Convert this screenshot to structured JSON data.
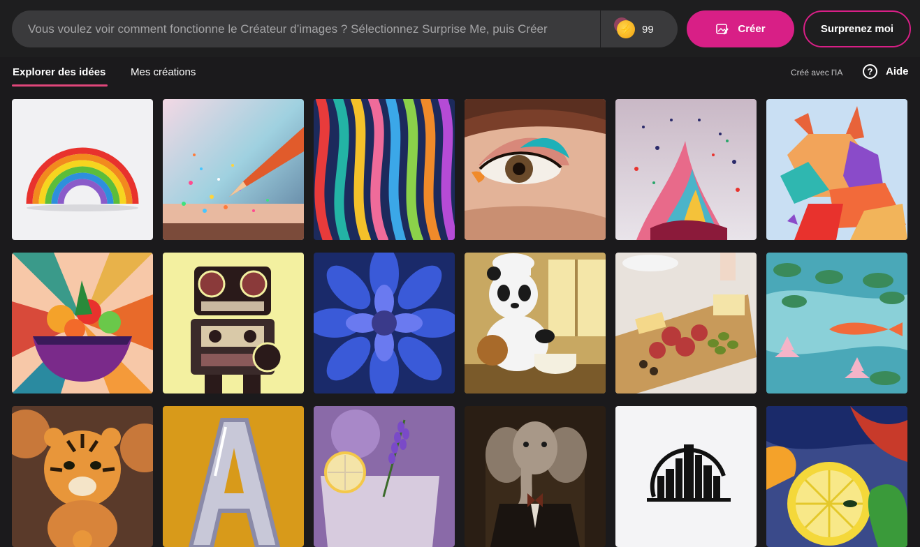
{
  "prompt": {
    "placeholder": "Vous voulez voir comment fonctionne le Créateur d’images ? Sélectionnez Surprise Me, puis Créer"
  },
  "boosts": {
    "count": "99"
  },
  "buttons": {
    "create": "Créer",
    "surprise": "Surprenez moi"
  },
  "tabs": [
    {
      "label": "Explorer des idées",
      "active": true
    },
    {
      "label": "Mes créations",
      "active": false
    }
  ],
  "ai_label": "Créé avec l'IA",
  "help": {
    "label": "Aide"
  },
  "gallery": [
    {
      "subject": "paper rainbow"
    },
    {
      "subject": "colored pencil with glitter"
    },
    {
      "subject": "colorful ribbons"
    },
    {
      "subject": "eye makeup"
    },
    {
      "subject": "paint splash"
    },
    {
      "subject": "paper wolf"
    },
    {
      "subject": "fruit bowl"
    },
    {
      "subject": "retro robot"
    },
    {
      "subject": "blue dahlia"
    },
    {
      "subject": "panda chef"
    },
    {
      "subject": "charcuterie board"
    },
    {
      "subject": "koi pond"
    },
    {
      "subject": "tiger"
    },
    {
      "subject": "chrome letter A"
    },
    {
      "subject": "lavender cocktail"
    },
    {
      "subject": "elephant in suit"
    },
    {
      "subject": "city skyline logo"
    },
    {
      "subject": "lemon painting"
    }
  ],
  "colors": {
    "accent": "#d81f86",
    "topbar": "#1e1e1f",
    "input": "#3a3a3c"
  }
}
